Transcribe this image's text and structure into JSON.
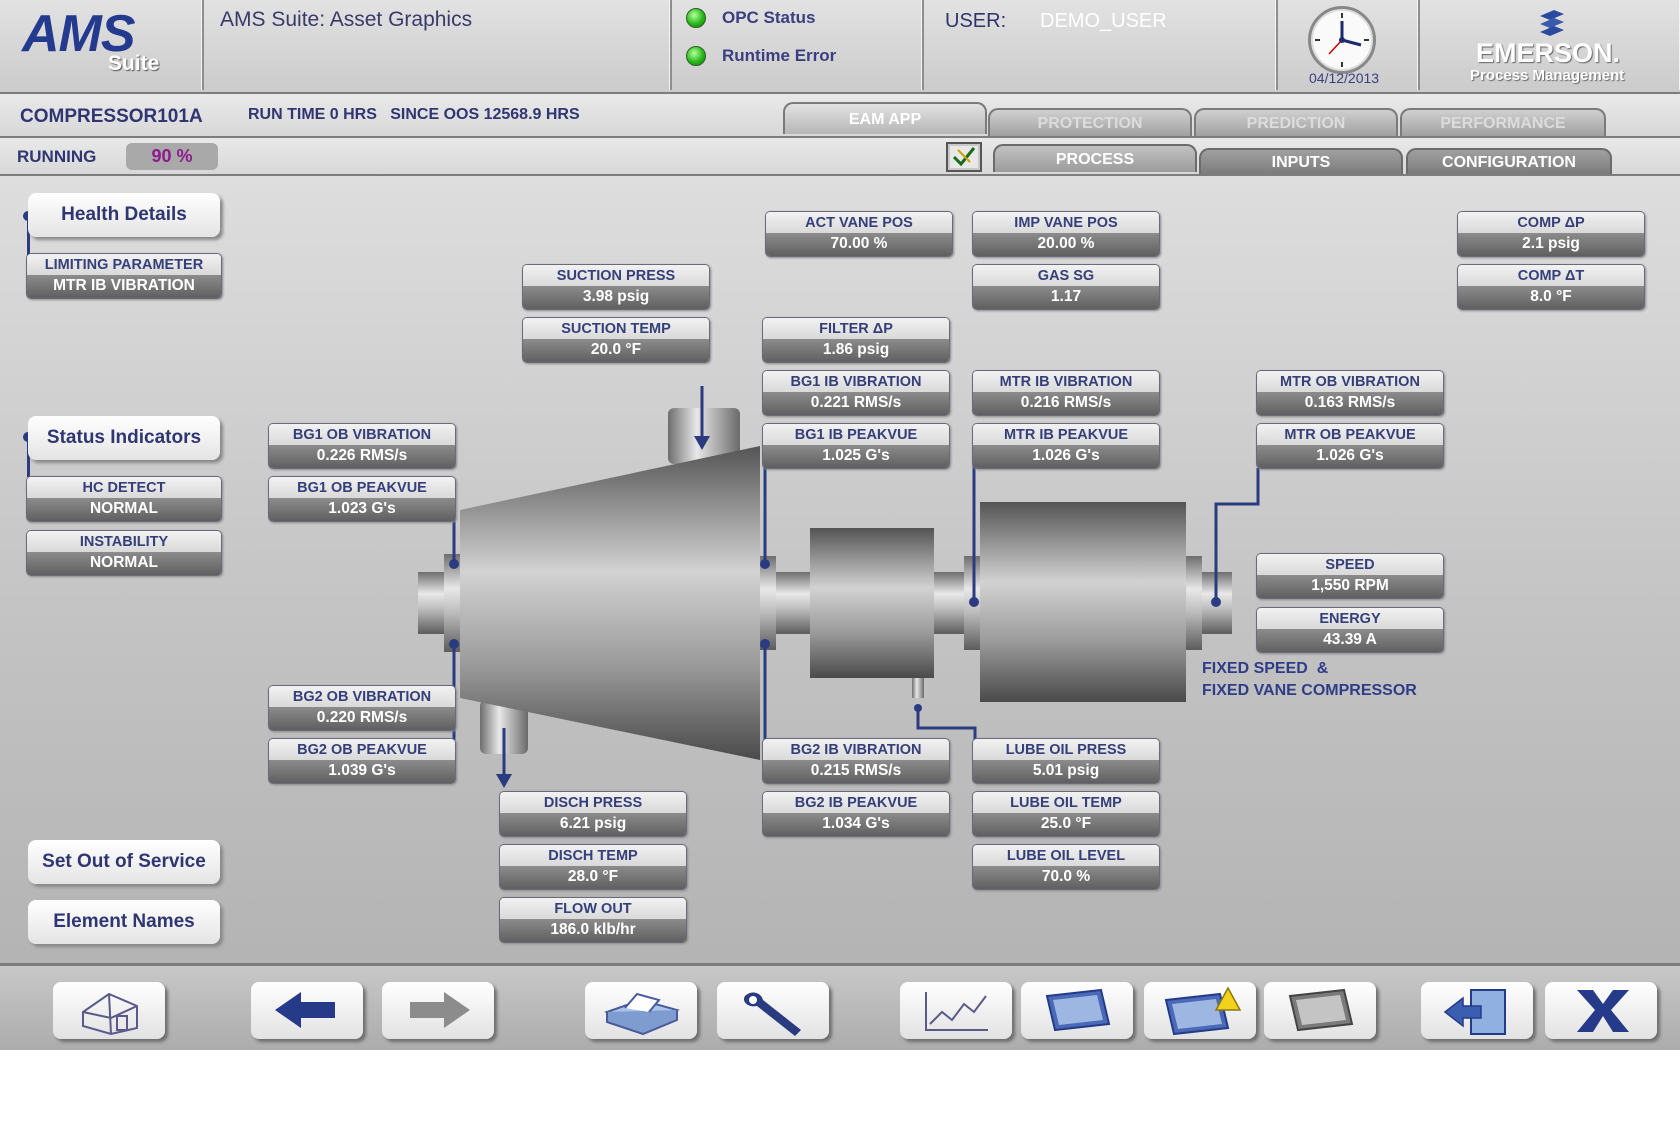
{
  "header": {
    "logo_main": "AMS",
    "logo_sub": "Suite",
    "app_title": "AMS Suite: Asset Graphics",
    "opc_status_label": "OPC Status",
    "runtime_error_label": "Runtime Error",
    "user_label": "USER:",
    "user_value": "DEMO_USER",
    "date": "04/12/2013",
    "brand": "EMERSON.",
    "brand_sub": "Process Management",
    "status_color": "#27b81c"
  },
  "equipment": {
    "name": "COMPRESSOR101A",
    "run_info": "RUN TIME 0 HRS   SINCE OOS 12568.9 HRS",
    "state": "RUNNING",
    "percent": "90 %"
  },
  "tabs_top": [
    {
      "label": "EAM APP",
      "active": true
    },
    {
      "label": "PROTECTION",
      "active": false
    },
    {
      "label": "PREDICTION",
      "active": false
    },
    {
      "label": "PERFORMANCE",
      "active": false
    }
  ],
  "tabs_sub": [
    {
      "label": "PROCESS",
      "active": true
    },
    {
      "label": "INPUTS",
      "active": false
    },
    {
      "label": "CONFIGURATION",
      "active": false
    }
  ],
  "sidebar": {
    "health_details": "Health Details",
    "limiting_parameter": {
      "label": "LIMITING PARAMETER",
      "value": "MTR IB VIBRATION"
    },
    "status_indicators": "Status Indicators",
    "hc_detect": {
      "label": "HC DETECT",
      "value": "NORMAL"
    },
    "instability": {
      "label": "INSTABILITY",
      "value": "NORMAL"
    },
    "set_out_of_service": "Set Out of Service",
    "element_names": "Element Names"
  },
  "parameters": {
    "act_vane_pos": {
      "label": "ACT VANE POS",
      "value": "70.00 %"
    },
    "imp_vane_pos": {
      "label": "IMP VANE POS",
      "value": "20.00 %"
    },
    "comp_dp": {
      "label": "COMP ΔP",
      "value": "2.1 psig"
    },
    "comp_dt": {
      "label": "COMP ΔT",
      "value": "8.0 °F"
    },
    "suction_press": {
      "label": "SUCTION PRESS",
      "value": "3.98 psig"
    },
    "gas_sg": {
      "label": "GAS SG",
      "value": "1.17"
    },
    "suction_temp": {
      "label": "SUCTION TEMP",
      "value": "20.0 °F"
    },
    "filter_dp": {
      "label": "FILTER ΔP",
      "value": "1.86 psig"
    },
    "bg1_ib_vibration": {
      "label": "BG1 IB VIBRATION",
      "value": "0.221 RMS/s"
    },
    "mtr_ib_vibration": {
      "label": "MTR IB VIBRATION",
      "value": "0.216 RMS/s"
    },
    "mtr_ob_vibration": {
      "label": "MTR OB VIBRATION",
      "value": "0.163 RMS/s"
    },
    "bg1_ob_vibration": {
      "label": "BG1 OB VIBRATION",
      "value": "0.226 RMS/s"
    },
    "bg1_ib_peakvue": {
      "label": "BG1 IB PEAKVUE",
      "value": "1.025 G's"
    },
    "mtr_ib_peakvue": {
      "label": "MTR IB PEAKVUE",
      "value": "1.026 G's"
    },
    "mtr_ob_peakvue": {
      "label": "MTR OB PEAKVUE",
      "value": "1.026 G's"
    },
    "bg1_ob_peakvue": {
      "label": "BG1 OB PEAKVUE",
      "value": "1.023 G's"
    },
    "speed": {
      "label": "SPEED",
      "value": "1,550 RPM"
    },
    "energy": {
      "label": "ENERGY",
      "value": "43.39 A"
    },
    "bg2_ob_vibration": {
      "label": "BG2 OB VIBRATION",
      "value": "0.220 RMS/s"
    },
    "bg2_ob_peakvue": {
      "label": "BG2 OB PEAKVUE",
      "value": "1.039 G's"
    },
    "bg2_ib_vibration": {
      "label": "BG2 IB VIBRATION",
      "value": "0.215 RMS/s"
    },
    "lube_oil_press": {
      "label": "LUBE OIL PRESS",
      "value": "5.01 psig"
    },
    "disch_press": {
      "label": "DISCH PRESS",
      "value": "6.21 psig"
    },
    "bg2_ib_peakvue": {
      "label": "BG2 IB PEAKVUE",
      "value": "1.034 G's"
    },
    "lube_oil_temp": {
      "label": "LUBE OIL TEMP",
      "value": "25.0 °F"
    },
    "disch_temp": {
      "label": "DISCH TEMP",
      "value": "28.0 °F"
    },
    "lube_oil_level": {
      "label": "LUBE OIL LEVEL",
      "value": "70.0 %"
    },
    "flow_out": {
      "label": "FLOW OUT",
      "value": "186.0 klb/hr"
    }
  },
  "caption": {
    "line1": "FIXED SPEED  &",
    "line2": "FIXED VANE COMPRESSOR"
  },
  "footer_icons": [
    "home-icon",
    "back-arrow-icon",
    "forward-arrow-icon",
    "printer-icon",
    "wrench-icon",
    "trend-chart-icon",
    "monitor-icon",
    "monitor-alert-icon",
    "monitor-gray-icon",
    "exit-door-icon",
    "close-x-icon"
  ]
}
